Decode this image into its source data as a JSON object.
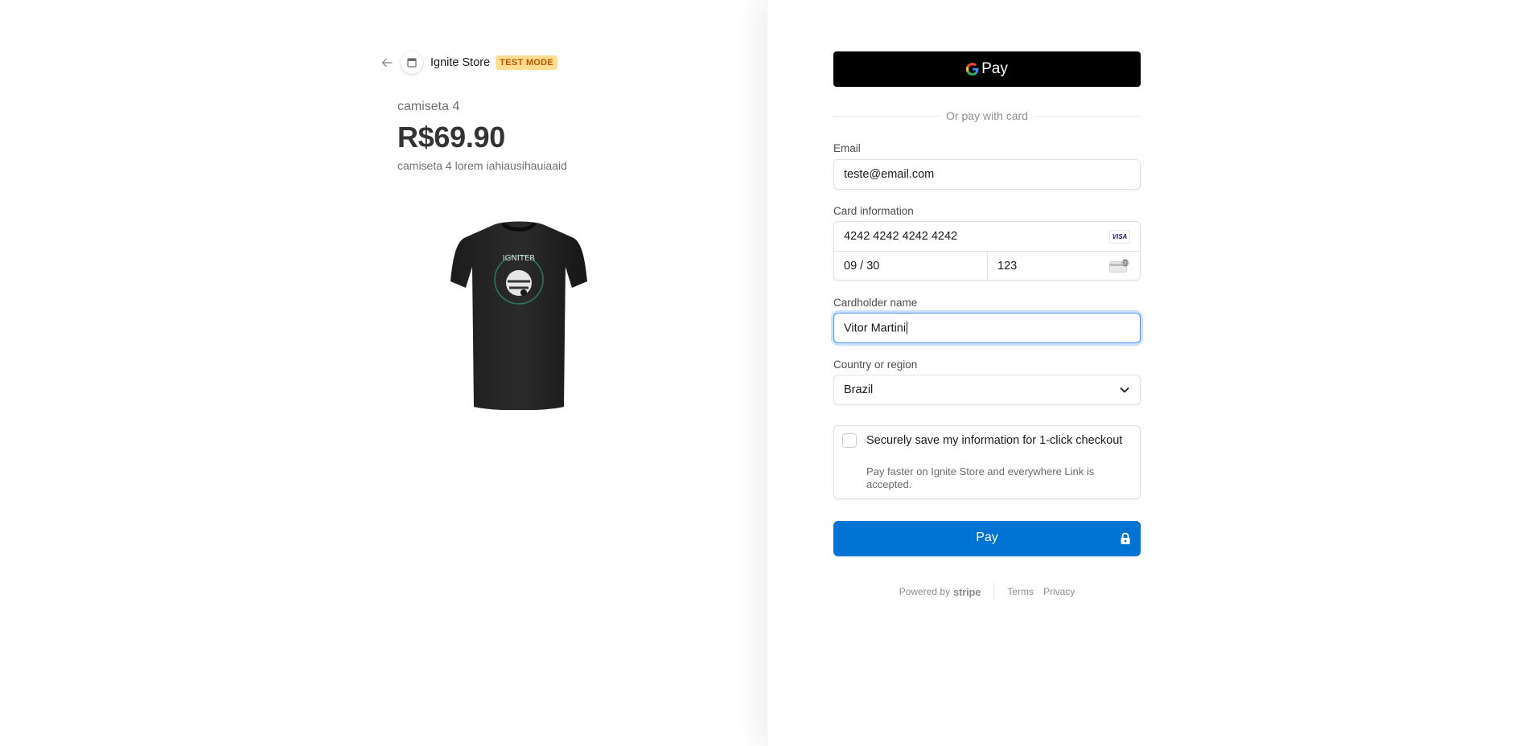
{
  "header": {
    "back_icon": "arrow-left-icon",
    "store_icon": "store-icon",
    "store_name": "Ignite Store",
    "badge": "TEST MODE"
  },
  "product": {
    "name": "camiseta 4",
    "price": "R$69.90",
    "description": "camiseta 4 lorem iahiausihauiaaid",
    "image": "black-tshirt-image"
  },
  "payment": {
    "gpay_label": "Pay",
    "divider_text": "Or pay with card",
    "email": {
      "label": "Email",
      "value": "teste@email.com"
    },
    "card": {
      "label": "Card information",
      "number": "4242 4242 4242 4242",
      "brand": "VISA",
      "expiry": "09 / 30",
      "cvc": "123"
    },
    "cardholder": {
      "label": "Cardholder name",
      "value": "Vitor Martini"
    },
    "country": {
      "label": "Country or region",
      "value": "Brazil"
    },
    "save_info": {
      "checked": false,
      "title": "Securely save my information for 1-click checkout",
      "description": "Pay faster on Ignite Store and everywhere Link is accepted."
    },
    "pay_button": "Pay"
  },
  "footer": {
    "powered_by": "Powered by",
    "stripe": "stripe",
    "terms": "Terms",
    "privacy": "Privacy"
  },
  "colors": {
    "pay_button": "#0074d4",
    "gpay_button": "#000000",
    "badge_bg": "#ffde92",
    "badge_text": "#bb5504",
    "focus_ring": "#4d90fe"
  }
}
